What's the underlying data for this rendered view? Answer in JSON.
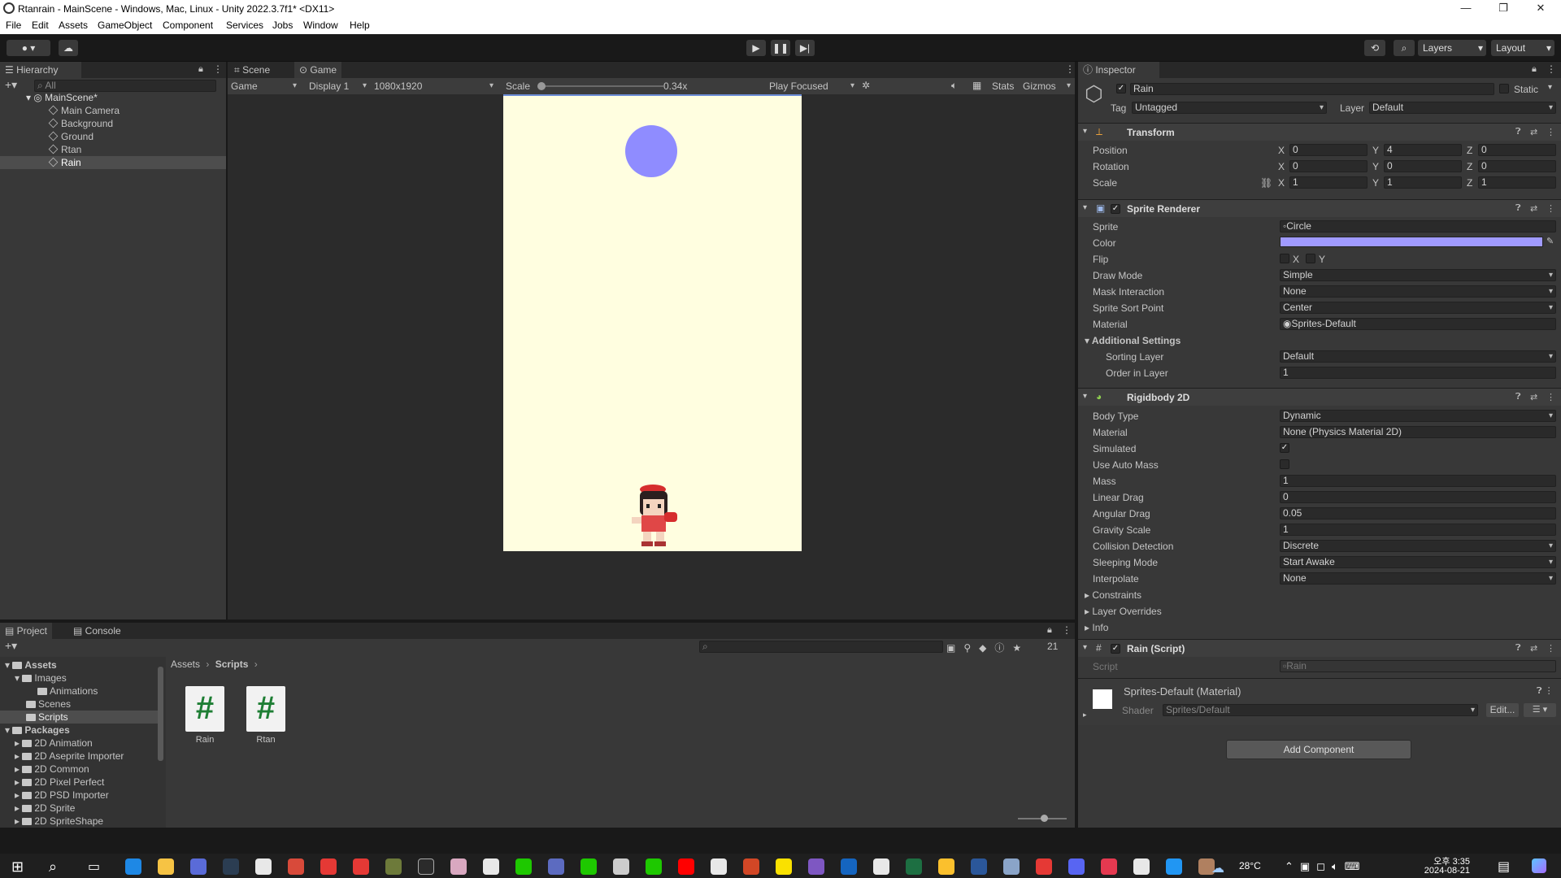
{
  "window": {
    "title": "Rtanrain - MainScene - Windows, Mac, Linux - Unity 2022.3.7f1* <DX11>"
  },
  "menu": [
    "File",
    "Edit",
    "Assets",
    "GameObject",
    "Component",
    "Services",
    "Jobs",
    "Window",
    "Help"
  ],
  "toolbar": {
    "layers": "Layers",
    "layout": "Layout"
  },
  "hierarchy": {
    "tab": "Hierarchy",
    "search_placeholder": "All",
    "scene": "MainScene*",
    "items": [
      "Main Camera",
      "Background",
      "Ground",
      "Rtan",
      "Rain"
    ]
  },
  "scene_tabs": {
    "scene": "Scene",
    "game": "Game"
  },
  "game_bar": {
    "mode": "Game",
    "display": "Display 1",
    "resolution": "1080x1920",
    "scale_label": "Scale",
    "scale_value": "0.34x",
    "play_focused": "Play Focused",
    "stats": "Stats",
    "gizmos": "Gizmos"
  },
  "game_view": {
    "bg": "#fffee0",
    "rain_color": "#8f8cff"
  },
  "bottom_tabs": {
    "project": "Project",
    "console": "Console"
  },
  "project": {
    "tree": {
      "assets": "Assets",
      "images": "Images",
      "animations": "Animations",
      "scenes": "Scenes",
      "scripts": "Scripts",
      "packages": "Packages",
      "package_items": [
        "2D Animation",
        "2D Aseprite Importer",
        "2D Common",
        "2D Pixel Perfect",
        "2D PSD Importer",
        "2D Sprite",
        "2D SpriteShape"
      ]
    },
    "breadcrumb": {
      "root": "Assets",
      "current": "Scripts"
    },
    "hidden_count": "21",
    "files": [
      "Rain",
      "Rtan"
    ]
  },
  "inspector": {
    "tab": "Inspector",
    "name": "Rain",
    "static": "Static",
    "tag_label": "Tag",
    "tag": "Untagged",
    "layer_label": "Layer",
    "layer": "Default",
    "transform": {
      "title": "Transform",
      "rows": [
        {
          "label": "Position",
          "x": "0",
          "y": "4",
          "z": "0"
        },
        {
          "label": "Rotation",
          "x": "0",
          "y": "0",
          "z": "0"
        },
        {
          "label": "Scale",
          "x": "1",
          "y": "1",
          "z": "1"
        }
      ]
    },
    "sprite_renderer": {
      "title": "Sprite Renderer",
      "sprite_label": "Sprite",
      "sprite": "Circle",
      "color_label": "Color",
      "color": "#a09aff",
      "flip_label": "Flip",
      "flip_x": "X",
      "flip_y": "Y",
      "draw_mode_label": "Draw Mode",
      "draw_mode": "Simple",
      "mask_label": "Mask Interaction",
      "mask": "None",
      "sort_point_label": "Sprite Sort Point",
      "sort_point": "Center",
      "material_label": "Material",
      "material": "Sprites-Default",
      "additional": "Additional Settings",
      "sorting_layer_label": "Sorting Layer",
      "sorting_layer": "Default",
      "order_label": "Order in Layer",
      "order": "1"
    },
    "rigidbody": {
      "title": "Rigidbody 2D",
      "body_type_label": "Body Type",
      "body_type": "Dynamic",
      "material_label": "Material",
      "material": "None (Physics Material 2D)",
      "simulated_label": "Simulated",
      "auto_mass_label": "Use Auto Mass",
      "mass_label": "Mass",
      "mass": "1",
      "linear_drag_label": "Linear Drag",
      "linear_drag": "0",
      "angular_drag_label": "Angular Drag",
      "angular_drag": "0.05",
      "gravity_label": "Gravity Scale",
      "gravity": "1",
      "collision_label": "Collision Detection",
      "collision": "Discrete",
      "sleeping_label": "Sleeping Mode",
      "sleeping": "Start Awake",
      "interpolate_label": "Interpolate",
      "interpolate": "None",
      "constraints": "Constraints",
      "layer_overrides": "Layer Overrides",
      "info": "Info"
    },
    "script": {
      "title": "Rain (Script)",
      "script_label": "Script",
      "script": "Rain"
    },
    "material": {
      "title": "Sprites-Default (Material)",
      "shader_label": "Shader",
      "shader": "Sprites/Default",
      "edit": "Edit..."
    },
    "add_component": "Add Component"
  },
  "taskbar": {
    "temp": "28°C",
    "time": "오후 3:35",
    "date": "2024-08-21"
  }
}
